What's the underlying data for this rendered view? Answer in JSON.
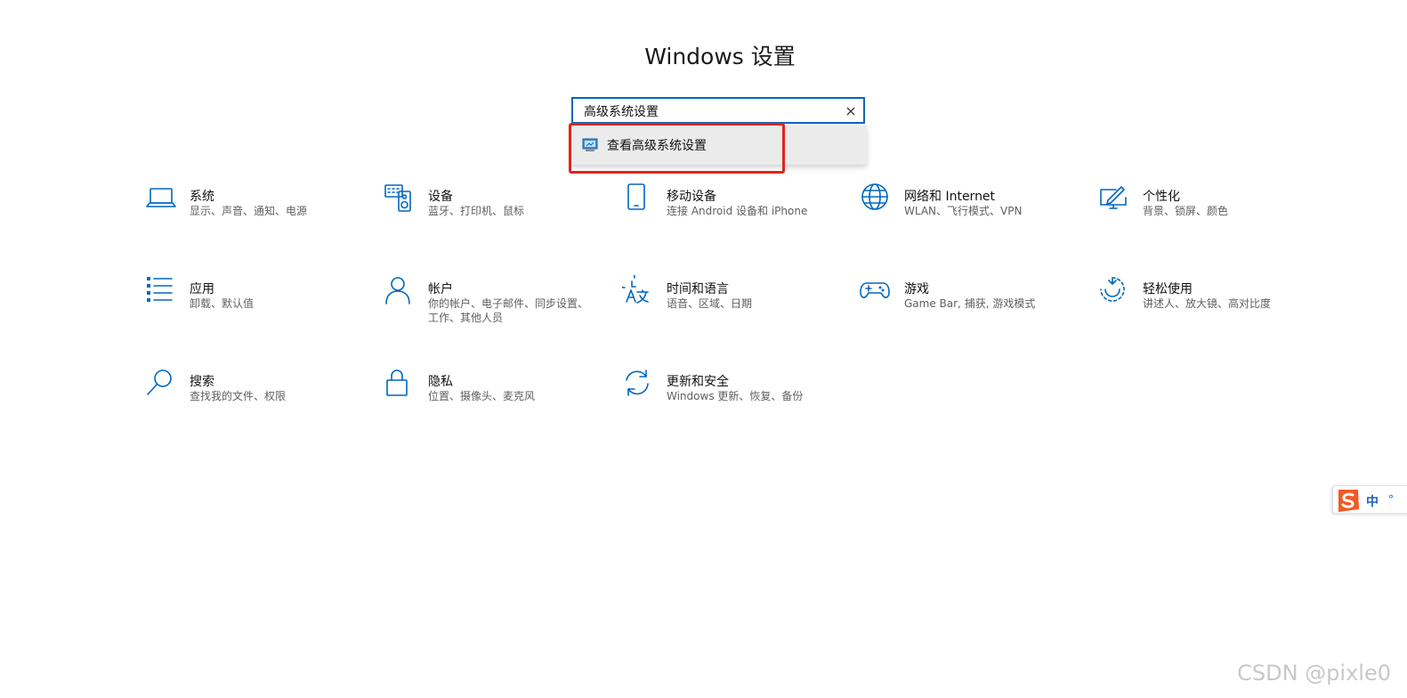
{
  "header": {
    "title": "Windows 设置"
  },
  "search": {
    "value": "高级系统设置",
    "suggestions": [
      {
        "label": "查看高级系统设置",
        "icon": "monitor-settings-icon"
      }
    ]
  },
  "categories": [
    {
      "name": "系统",
      "desc": "显示、声音、通知、电源",
      "icon": "laptop-icon"
    },
    {
      "name": "设备",
      "desc": "蓝牙、打印机、鼠标",
      "icon": "keyboard-speaker-icon"
    },
    {
      "name": "移动设备",
      "desc": "连接 Android 设备和 iPhone",
      "icon": "phone-icon"
    },
    {
      "name": "网络和 Internet",
      "desc": "WLAN、飞行模式、VPN",
      "icon": "globe-icon"
    },
    {
      "name": "个性化",
      "desc": "背景、锁屏、颜色",
      "icon": "paint-monitor-icon"
    },
    {
      "name": "应用",
      "desc": "卸载、默认值",
      "icon": "app-list-icon"
    },
    {
      "name": "帐户",
      "desc": "你的帐户、电子邮件、同步设置、工作、其他人员",
      "icon": "person-icon"
    },
    {
      "name": "时间和语言",
      "desc": "语音、区域、日期",
      "icon": "time-language-icon"
    },
    {
      "name": "游戏",
      "desc": "Game Bar, 捕获, 游戏模式",
      "icon": "gamepad-icon"
    },
    {
      "name": "轻松使用",
      "desc": "讲述人、放大镜、高对比度",
      "icon": "ease-of-access-icon"
    },
    {
      "name": "搜索",
      "desc": "查找我的文件、权限",
      "icon": "search-icon"
    },
    {
      "name": "隐私",
      "desc": "位置、摄像头、麦克风",
      "icon": "lock-icon"
    },
    {
      "name": "更新和安全",
      "desc": "Windows 更新、恢复、备份",
      "icon": "sync-arrows-icon"
    }
  ],
  "ime": {
    "mode": "中",
    "indicator": "°",
    "icon": "sogou-logo-icon"
  },
  "watermark": "CSDN @pixle0",
  "colors": {
    "accent": "#0067c0",
    "highlight": "#e0231c"
  }
}
